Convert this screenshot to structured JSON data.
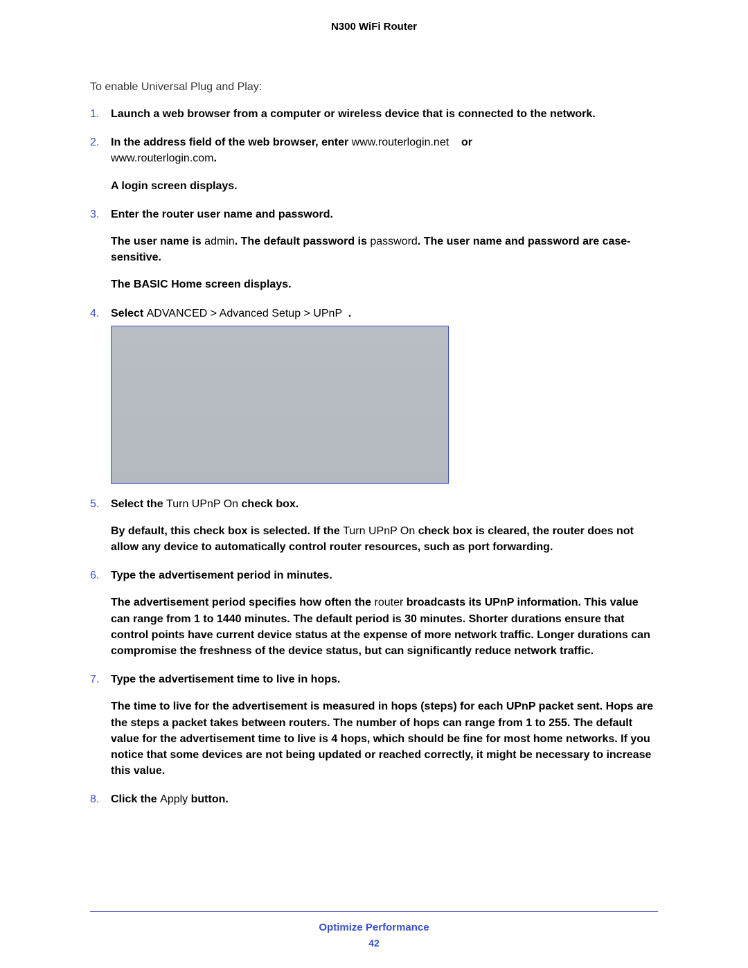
{
  "header": {
    "title": "N300 WiFi Router"
  },
  "intro": "To enable Universal Plug and Play:",
  "steps": [
    {
      "num": "1.",
      "main_bold": "Launch a web browser from a computer or wireless device that is connected to the network."
    },
    {
      "num": "2.",
      "pre_bold": "In the address field of the web browser, enter",
      "url1": "www.routerlogin.net",
      "or_text": "or",
      "url2": "www.routerlogin.com",
      "period": ".",
      "sub1": "A login screen displays."
    },
    {
      "num": "3.",
      "main_bold": "Enter the router user name and password.",
      "sub_parts": {
        "a": "The user name is ",
        "admin": "admin",
        "b": ". The default password is ",
        "password": "password",
        "c": ". The user name and password are case-sensitive."
      },
      "sub2": "The BASIC Home screen displays."
    },
    {
      "num": "4.",
      "pre_bold": "Select ",
      "path": "ADVANCED > Advanced Setup > UPnP",
      "period": "."
    },
    {
      "num": "5.",
      "pre_bold": "Select the ",
      "mid_normal": "Turn UPnP On",
      "post_bold": " check box.",
      "sub_parts": {
        "a": "By default, this check box is selected. If the ",
        "turn": "Turn UPnP On",
        "b": " check box is cleared, the router does not allow any device to automatically control router resources, such as port forwarding."
      }
    },
    {
      "num": "6.",
      "main_bold": "Type the advertisement period in minutes.",
      "sub_parts": {
        "a": "The advertisement period specifies how often the ",
        "router1": "router ",
        "b": "broadcasts its UPnP information. This value can range from 1 to 1440 minutes. The default period is 30 minutes. Shorter durations ensure that control points have current device status at the expense of more network traffic. Longer durations can compromise the freshness of the device status, but can significantly reduce network traffic."
      }
    },
    {
      "num": "7.",
      "main_bold": "Type the advertisement time to live in hops.",
      "sub_parts": {
        "a": "The time to live for the advertisement is measured in hops (steps) for each UPnP packet sent. Hops are the steps a packet takes between routers. The number of hops can range from 1 to 255. The default value for the advertisement time to live is 4 hops, which should be fine for most home networks. If you notice that some devices are not being updated or reached correctly, it might be necessary to increase this value."
      }
    },
    {
      "num": "8.",
      "pre_bold": "Click the ",
      "mid_normal": "Apply",
      "post_bold": " button."
    }
  ],
  "footer": {
    "section": "Optimize Performance",
    "page": "42"
  }
}
